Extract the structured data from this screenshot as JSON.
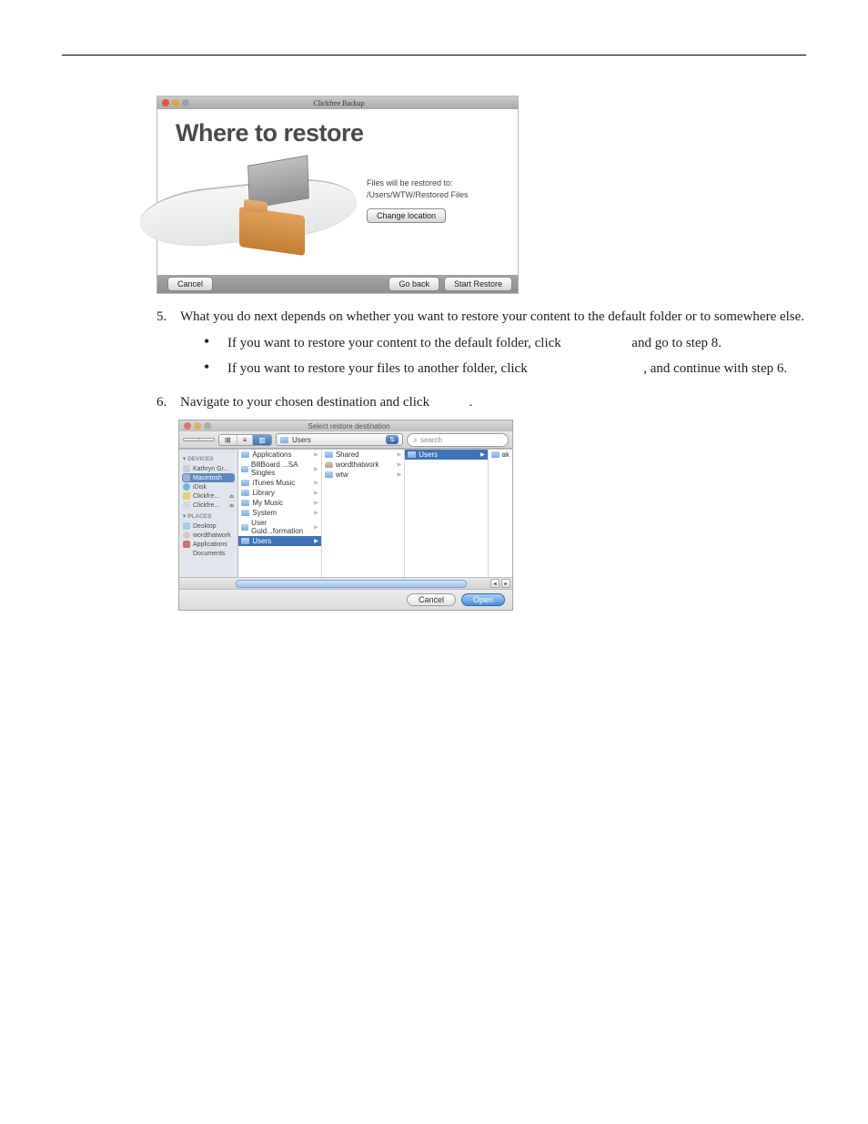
{
  "shot1": {
    "window_title": "Clickfree Backup",
    "heading": "Where to restore",
    "msg1": "Files will be restored to:",
    "msg2": "/Users/WTW/Restored Files",
    "change": "Change location",
    "cancel": "Cancel",
    "goback": "Go back",
    "start": "Start Restore"
  },
  "steps": {
    "s5": "What you do next depends on whether you want to restore your content to the default folder or to somewhere else.",
    "s5a": "If you want to restore your content to the default folder, click",
    "s5a_tail": "and go to step 8.",
    "s5b": "If you want to restore your files to another folder, click",
    "s5b_tail": ", and continue with step 6.",
    "s6": "Navigate to your chosen destination and click",
    "s6_tail": "."
  },
  "shot2": {
    "window_title": "Select restore destination",
    "path_label": "Users",
    "search_placeholder": "search",
    "sidebar": {
      "devices_h": "DEVICES",
      "devices": [
        "Kathryn Gr...",
        "Macintosh",
        "iDisk",
        "Clickfre...",
        "Clickfre..."
      ],
      "places_h": "PLACES",
      "places": [
        "Desktop",
        "wordthatwork",
        "Applications",
        "Documents"
      ]
    },
    "col1": [
      "Applications",
      "BillBoard ...SA Singles",
      "iTunes Music",
      "Library",
      "My Music",
      "System",
      "User Guid...formation",
      "Users"
    ],
    "col2": [
      "Shared",
      "wordthatwork",
      "wtw"
    ],
    "col3": [
      "Users"
    ],
    "col4_item": "ak",
    "cancel": "Cancel",
    "open": "Open"
  }
}
